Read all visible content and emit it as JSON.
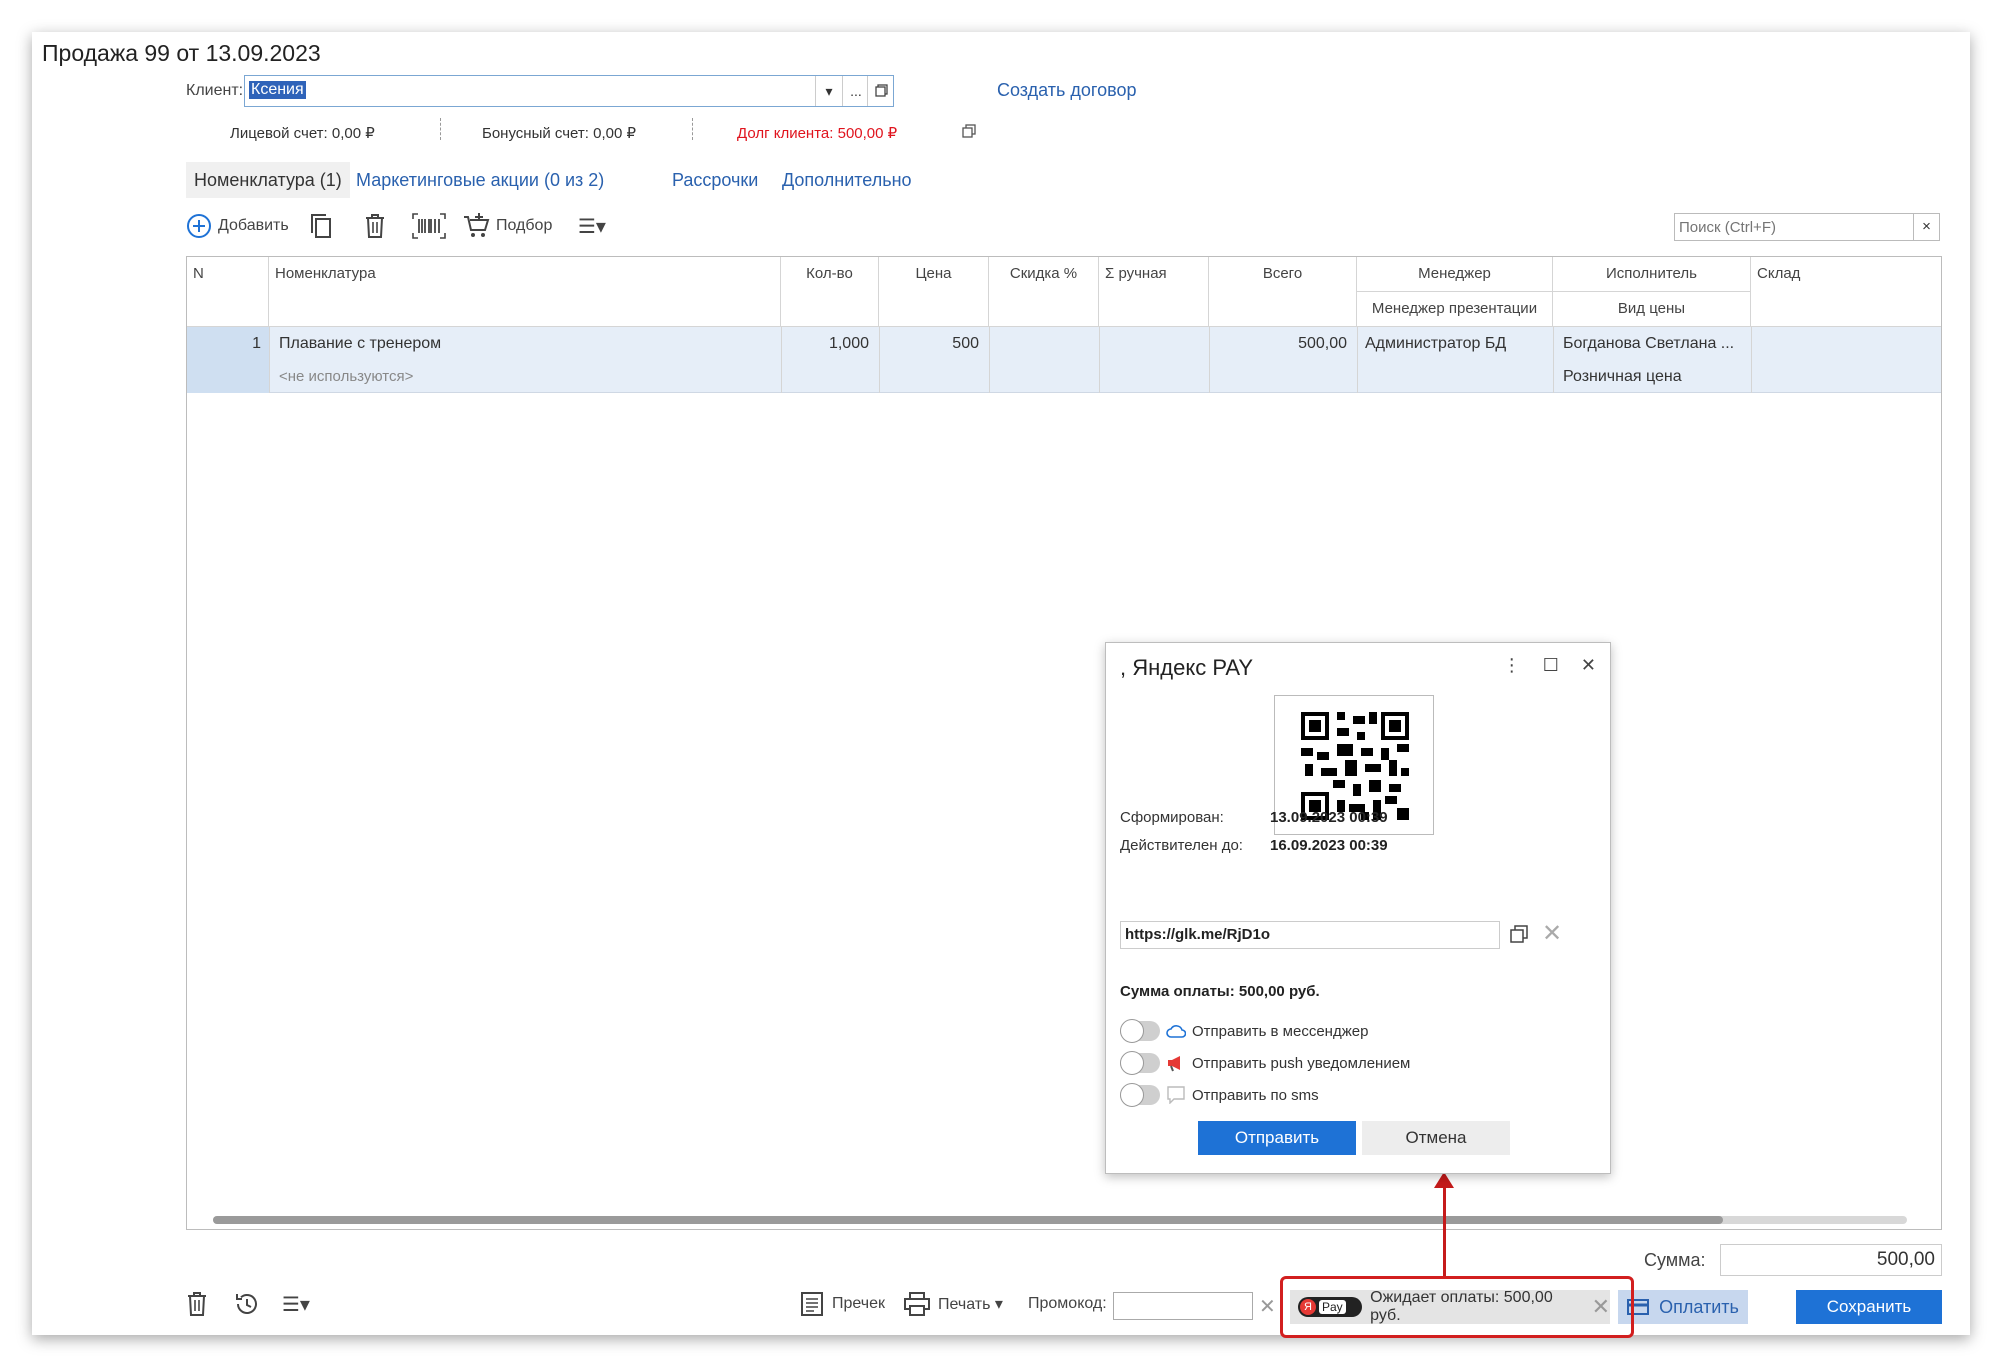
{
  "window": {
    "title": "Продажа 99 от 13.09.2023"
  },
  "client": {
    "label": "Клиент:",
    "value": "Ксения",
    "dropdown_glyph": "▾",
    "select_glyph": "...",
    "create_contract": "Создать договор"
  },
  "accounts": {
    "personal": "Лицевой счет: 0,00 ₽",
    "bonus": "Бонусный счет: 0,00 ₽",
    "debt": "Долг клиента: 500,00 ₽"
  },
  "tabs": [
    {
      "label": "Номенклатура (1)"
    },
    {
      "label": "Маркетинговые акции (0 из 2)"
    },
    {
      "label": "Рассрочки"
    },
    {
      "label": "Дополнительно"
    }
  ],
  "toolbar": {
    "add": "Добавить",
    "pick": "Подбор",
    "more_glyph": "☰▾"
  },
  "search": {
    "placeholder": "Поиск (Ctrl+F)",
    "clear": "×"
  },
  "table": {
    "headers": {
      "n": "N",
      "item": "Номенклатура",
      "qty": "Кол-во",
      "price": "Цена",
      "discount": "Скидка %",
      "manual": "Σ ручная",
      "total": "Всего",
      "manager": "Менеджер",
      "presentation_manager": "Менеджер презентации",
      "executor": "Исполнитель",
      "price_type": "Вид цены",
      "warehouse": "Склад"
    },
    "rows": [
      {
        "n": "1",
        "item": "Плавание с тренером",
        "sub": "<не используются>",
        "qty": "1,000",
        "price": "500",
        "total": "500,00",
        "manager": "Администратор БД",
        "executor": "Богданова Светлана ...",
        "price_type": "Розничная цена"
      }
    ]
  },
  "summary": {
    "label": "Сумма:",
    "value": "500,00"
  },
  "bottom": {
    "precheck": "Пречек",
    "print": "Печать ▾",
    "promo_label": "Промокод:",
    "awaiting": "Ожидает оплаты: 500,00 руб.",
    "chip_y": "Я",
    "chip_pay": "Pay",
    "pay": "Оплатить",
    "save": "Сохранить"
  },
  "dialog": {
    "title": ", Яндекс PAY",
    "created_label": "Сформирован:",
    "created_value": "13.09.2023 00:39",
    "valid_label": "Действителен до:",
    "valid_value": "16.09.2023 00:39",
    "url": "https://glk.me/RjD1o",
    "sum": "Сумма оплаты: 500,00 руб.",
    "options": [
      {
        "label": "Отправить в мессенджер"
      },
      {
        "label": "Отправить push уведомлением"
      },
      {
        "label": "Отправить по sms"
      }
    ],
    "send": "Отправить",
    "cancel": "Отмена"
  },
  "colors": {
    "accent": "#1e72d6",
    "link": "#2a61ae",
    "debt_red": "#e0141e",
    "highlight_red": "#d21f1f",
    "row_selected": "#e6eef8"
  }
}
